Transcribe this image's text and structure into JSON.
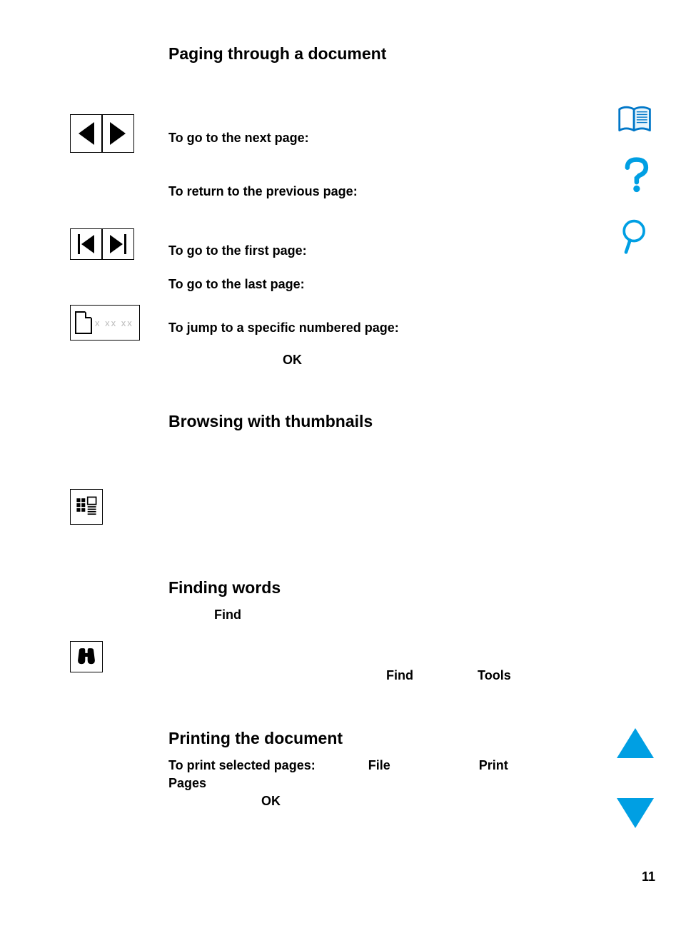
{
  "sections": {
    "paging": {
      "heading": "Paging through a document",
      "next_page": "To go to the next page:",
      "prev_page": "To return to the previous page:",
      "first_page": "To go to the first page:",
      "last_page": "To go to the last page:",
      "jump": "To jump to a specific numbered page:",
      "ok": "OK"
    },
    "thumbnails": {
      "heading": "Browsing with thumbnails"
    },
    "finding": {
      "heading": "Finding words",
      "find1": "Find",
      "find2": "Find",
      "tools": "Tools"
    },
    "printing": {
      "heading": "Printing the document",
      "print_sel": "To print selected pages:",
      "file": "File",
      "print": "Print",
      "pages": "Pages",
      "ok": "OK"
    }
  },
  "icons": {
    "goto_placeholder": "x xx xx"
  },
  "page_number": "11"
}
